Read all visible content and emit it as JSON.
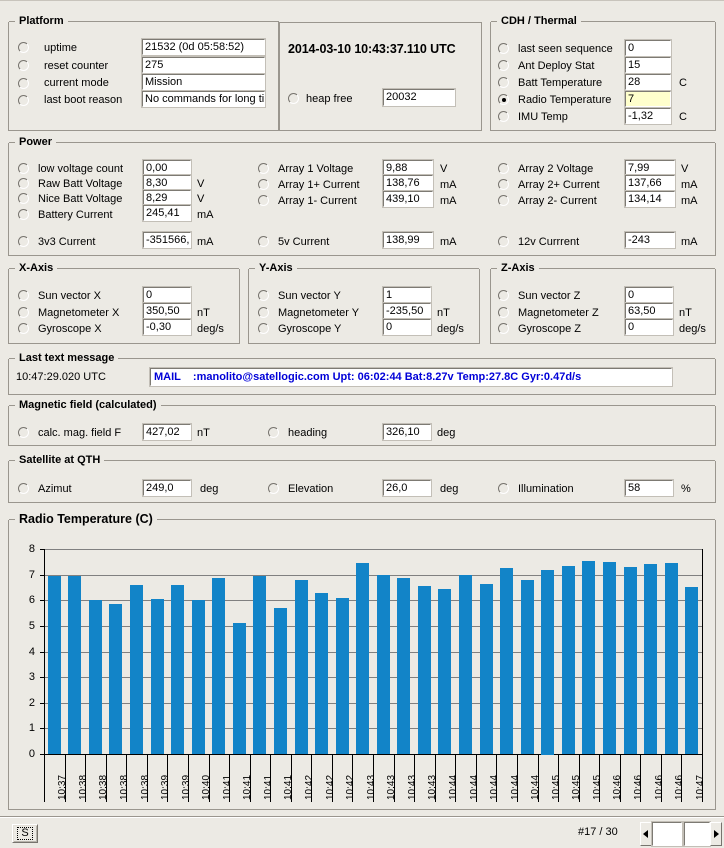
{
  "platform": {
    "title": "Platform",
    "rows": [
      {
        "label": "uptime",
        "value": "21532  (0d 05:58:52)",
        "selected": false
      },
      {
        "label": "reset counter",
        "value": "275",
        "selected": false
      },
      {
        "label": "current mode",
        "value": "Mission",
        "selected": false
      },
      {
        "label": "last boot reason",
        "value": "No commands for long ti",
        "selected": false
      }
    ]
  },
  "clock": {
    "utc": "2014-03-10 10:43:37.110 UTC",
    "heap_label": "heap free",
    "heap_value": "20032",
    "heap_selected": false
  },
  "cdh": {
    "title": "CDH / Thermal",
    "rows": [
      {
        "label": "last seen sequence",
        "value": "0",
        "unit": "",
        "selected": false,
        "highlight": false
      },
      {
        "label": "Ant Deploy Stat",
        "value": "15",
        "unit": "",
        "selected": false,
        "highlight": false
      },
      {
        "label": "Batt Temperature",
        "value": "28",
        "unit": "C",
        "selected": false,
        "highlight": false
      },
      {
        "label": "Radio Temperature",
        "value": "7",
        "unit": "",
        "selected": true,
        "highlight": true
      },
      {
        "label": "IMU Temp",
        "value": "-1,32",
        "unit": "C",
        "selected": false,
        "highlight": false
      }
    ]
  },
  "power": {
    "title": "Power",
    "col1": [
      {
        "label": "low voltage count",
        "value": "0,00",
        "unit": "",
        "selected": false
      },
      {
        "label": "Raw Batt Voltage",
        "value": "8,30",
        "unit": "V",
        "selected": false
      },
      {
        "label": "Nice Batt Voltage",
        "value": "8,29",
        "unit": "V",
        "selected": false
      },
      {
        "label": "Battery Current",
        "value": "245,41",
        "unit": "mA",
        "selected": false
      }
    ],
    "col1_extra": {
      "label": "3v3 Current",
      "value": "-351566,",
      "unit": "mA",
      "selected": false
    },
    "col2": [
      {
        "label": "Array 1 Voltage",
        "value": "9,88",
        "unit": "V",
        "selected": false
      },
      {
        "label": "Array 1+ Current",
        "value": "138,76",
        "unit": "mA",
        "selected": false
      },
      {
        "label": "Array 1- Current",
        "value": "439,10",
        "unit": "mA",
        "selected": false
      }
    ],
    "col2_extra": {
      "label": "5v Current",
      "value": "138,99",
      "unit": "mA",
      "selected": false
    },
    "col3": [
      {
        "label": "Array 2 Voltage",
        "value": "7,99",
        "unit": "V",
        "selected": false
      },
      {
        "label": "Array 2+ Current",
        "value": "137,66",
        "unit": "mA",
        "selected": false
      },
      {
        "label": "Array 2- Current",
        "value": "134,14",
        "unit": "mA",
        "selected": false
      }
    ],
    "col3_extra": {
      "label": "12v Currrent",
      "value": "-243",
      "unit": "mA",
      "selected": false
    }
  },
  "xaxis": {
    "title": "X-Axis",
    "rows": [
      {
        "label": "Sun vector X",
        "value": "0",
        "unit": "",
        "selected": false
      },
      {
        "label": "Magnetometer X",
        "value": "350,50",
        "unit": "nT",
        "selected": false
      },
      {
        "label": "Gyroscope X",
        "value": "-0,30",
        "unit": "deg/s",
        "selected": false
      }
    ]
  },
  "yaxis": {
    "title": "Y-Axis",
    "rows": [
      {
        "label": "Sun vector Y",
        "value": "1",
        "unit": "",
        "selected": false
      },
      {
        "label": "Magnetometer Y",
        "value": "-235,50",
        "unit": "nT",
        "selected": false
      },
      {
        "label": "Gyroscope Y",
        "value": "0",
        "unit": "deg/s",
        "selected": false
      }
    ]
  },
  "zaxis": {
    "title": "Z-Axis",
    "rows": [
      {
        "label": "Sun vector Z",
        "value": "0",
        "unit": "",
        "selected": false
      },
      {
        "label": "Magnetometer Z",
        "value": "63,50",
        "unit": "nT",
        "selected": false
      },
      {
        "label": "Gyroscope Z",
        "value": "0",
        "unit": "deg/s",
        "selected": false
      }
    ]
  },
  "lastmsg": {
    "title": "Last text message",
    "timestamp": "10:47:29.020 UTC",
    "text": "MAIL    :manolito@satellogic.com Upt: 06:02:44 Bat:8.27v Temp:27.8C Gyr:0.47d/s",
    "color": "#0000d8"
  },
  "magfield": {
    "title": "Magnetic field (calculated)",
    "rows": [
      {
        "label": "calc. mag. field F",
        "value": "427,02",
        "unit": "nT",
        "selected": false
      },
      {
        "label": "heading",
        "value": "326,10",
        "unit": "deg",
        "selected": false
      }
    ]
  },
  "satqth": {
    "title": "Satellite at QTH",
    "rows": [
      {
        "label": "Azimut",
        "value": "249,0",
        "unit": "deg",
        "selected": false
      },
      {
        "label": "Elevation",
        "value": "26,0",
        "unit": "deg",
        "selected": false
      },
      {
        "label": "Illumination",
        "value": "58",
        "unit": "%",
        "selected": false
      }
    ]
  },
  "chart_data": {
    "type": "bar",
    "title": "Radio Temperature  (C)",
    "xlabel": "",
    "ylabel": "",
    "ylim": [
      0,
      8
    ],
    "yticks": [
      0,
      1,
      2,
      3,
      4,
      5,
      6,
      7,
      8
    ],
    "grid": true,
    "legend": null,
    "bar_color": "#1284c8",
    "categories": [
      "10:37",
      "10:38",
      "10:38",
      "10:38",
      "10:38",
      "10:39",
      "10:39",
      "10:40",
      "10:41",
      "10:41",
      "10:41",
      "10:41",
      "10:42",
      "10:42",
      "10:42",
      "10:43",
      "10:43",
      "10:43",
      "10:43",
      "10:44",
      "10:44",
      "10:44",
      "10:44",
      "10:44",
      "10:45",
      "10:45",
      "10:45",
      "10:46",
      "10:46",
      "10:46",
      "10:46",
      "10:47"
    ],
    "values": [
      6.95,
      6.95,
      6.0,
      5.85,
      6.6,
      6.05,
      6.6,
      6.0,
      6.85,
      5.1,
      6.95,
      5.7,
      6.8,
      6.3,
      6.1,
      7.45,
      7.0,
      6.85,
      6.55,
      6.45,
      7.0,
      6.65,
      7.25,
      6.8,
      7.2,
      7.35,
      7.55,
      7.5,
      7.3,
      7.4,
      7.45,
      6.5
    ]
  },
  "statusbar": {
    "s_button": "S",
    "page_indicator": "#17 / 30",
    "spin_value": "",
    "left_arrow": "◀",
    "right_arrow": "▶"
  }
}
